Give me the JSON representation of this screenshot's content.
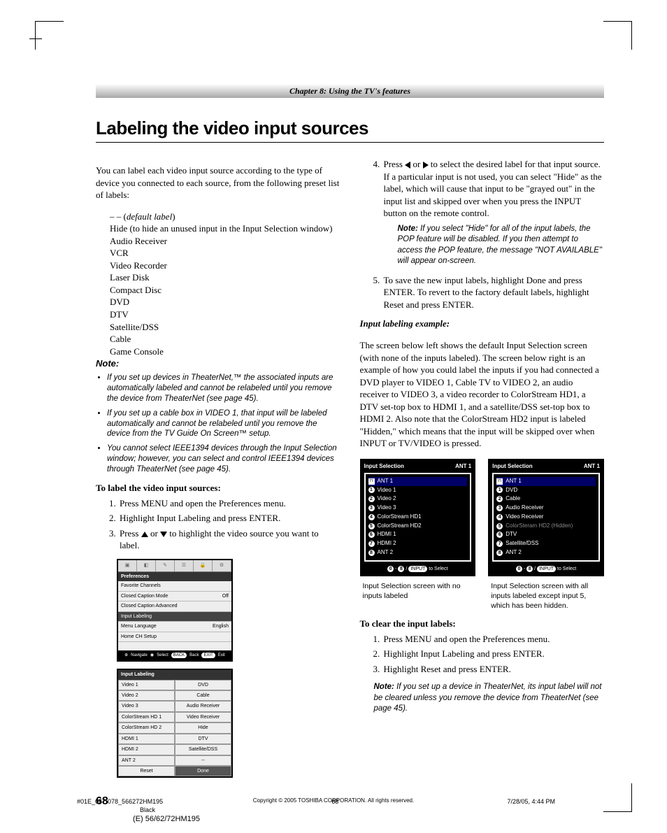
{
  "chapter": "Chapter 8: Using the TV's features",
  "section_title": "Labeling the video input sources",
  "left": {
    "intro": "You can label each video input source according to the type of device you connected to each source, from the following preset list of labels:",
    "labels": {
      "l0a": "– – (",
      "l0b": "default label",
      "l0c": ")",
      "l1": "Hide (to hide an unused input in the Input Selection window)",
      "l2": "Audio Receiver",
      "l3": "VCR",
      "l4": "Video Recorder",
      "l5": "Laser Disk",
      "l6": "Compact Disc",
      "l7": "DVD",
      "l8": "DTV",
      "l9": "Satellite/DSS",
      "l10": "Cable",
      "l11": "Game Console"
    },
    "note_label": "Note:",
    "notes": {
      "n1": "If you set up devices in TheaterNet,™ the associated inputs are automatically labeled and cannot be relabeled until you remove the device from TheaterNet (see page 45).",
      "n2": "If you set up a cable box in VIDEO 1, that input will be labeled automatically and cannot be relabeled until you remove the device from the TV Guide On Screen™ setup.",
      "n3": "You cannot select IEEE1394 devices through the Input Selection window; however, you can select and control IEEE1394 devices through TheaterNet (see page 45)."
    },
    "to_label": "To label the video input sources:",
    "steps": {
      "s1": "Press MENU and open the Preferences menu.",
      "s2": "Highlight Input Labeling and press ENTER.",
      "s3a": "Press ",
      "s3b": " or ",
      "s3c": " to highlight the video source you want to label."
    },
    "osd_pref": {
      "title": "Preferences",
      "rows": {
        "r1a": "Favorite Channels",
        "r1b": "",
        "r2a": "Closed Caption Mode",
        "r2b": "Off",
        "r3a": "Closed Caption Advanced",
        "r3b": "",
        "r4a": "Input Labeling",
        "r4b": "",
        "r5a": "Menu Language",
        "r5b": "English",
        "r6a": "Home CH Setup",
        "r6b": ""
      },
      "footer": {
        "nav": "Navigate",
        "sel": "Select",
        "back_pill": "BACK",
        "back": "Back",
        "exit_pill": "EXIT",
        "exit": "Exit"
      }
    },
    "osd_label": {
      "title": "Input Labeling",
      "rows": {
        "r1a": "Video 1",
        "r1b": "DVD",
        "r2a": "Video 2",
        "r2b": "Cable",
        "r3a": "Video 3",
        "r3b": "Audio Receiver",
        "r4a": "ColorStream HD 1",
        "r4b": "Video Receiver",
        "r5a": "ColorStream HD 2",
        "r5b": "Hide",
        "r6a": "HDMI 1",
        "r6b": "DTV",
        "r7a": "HDMI 2",
        "r7b": "Satellite/DSS",
        "r8a": "ANT 2",
        "r8b": "--"
      },
      "reset": "Reset",
      "done": "Done"
    }
  },
  "right": {
    "steps": {
      "s4a": "Press ",
      "s4b": " or ",
      "s4c": " to select the desired label for that input source. If a particular input is not used, you can select \"Hide\" as the label, which will cause that input to be \"grayed out\" in the input list and skipped over when you press the INPUT button on the remote control.",
      "s5": "To save the new input labels, highlight Done and press ENTER. To revert to the factory default labels, highlight Reset and press ENTER."
    },
    "note4_label": "Note:",
    "note4": " If you select \"Hide\" for all of the input labels, the POP feature will be disabled. If you then attempt to access the POP feature, the message \"NOT AVAILABLE\" will appear on-screen.",
    "example_head": "Input labeling example:",
    "example_body": "The screen below left shows the default Input Selection screen (with none of the inputs labeled). The screen below right is an example of how you could label the inputs if you had connected a DVD player to VIDEO 1, Cable TV to VIDEO 2, an audio receiver to VIDEO 3, a video recorder to ColorStream HD1, a DTV set-top box to HDMI 1, and a satellite/DSS set-top box to HDMI 2. Also note that the ColorStream HD2 input is labeled \"Hidden,\" which means that the input will be skipped over when INPUT or TV/VIDEO is pressed.",
    "isel_left": {
      "title": "Input Selection",
      "ant": "ANT 1",
      "i0": "ANT 1",
      "i1": "Video 1",
      "i2": "Video 2",
      "i3": "Video 3",
      "i4": "ColorStream HD1",
      "i5": "ColorStream HD2",
      "i6": "HDMI 1",
      "i7": "HDMI 2",
      "i8": "ANT 2",
      "footer_end": " to Select",
      "footer_pill": "INPUT",
      "caption": "Input Selection screen with no inputs labeled"
    },
    "isel_right": {
      "title": "Input Selection",
      "ant": "ANT 1",
      "i0": "ANT 1",
      "i1": "DVD",
      "i2": "Cable",
      "i3": "Audio Receiver",
      "i4": "Video Receiver",
      "i5": "ColorSteram HD2 (Hidden)",
      "i6": "DTV",
      "i7": "Satellite/DSS",
      "i8": "ANT 2",
      "caption": "Input Selection screen with all inputs labeled except input 5, which has been hidden."
    },
    "clear_head": "To clear the input labels:",
    "clear": {
      "c1": "Press MENU and open the Preferences menu.",
      "c2": "Highlight Input Labeling and press ENTER.",
      "c3": "Highlight Reset and press ENTER."
    },
    "note5_label": "Note:",
    "note5": " If you set up a device in TheaterNet, its input label will not be cleared unless you remove the device from TheaterNet (see page 45)."
  },
  "footer": {
    "page": "68",
    "copyright": "Copyright © 2005 TOSHIBA CORPORATION. All rights reserved.",
    "file": "#01E_067-078_566272HM195",
    "pg": "68",
    "date": "7/28/05, 4:44 PM",
    "black": "Black",
    "model": "(E) 56/62/72HM195"
  }
}
